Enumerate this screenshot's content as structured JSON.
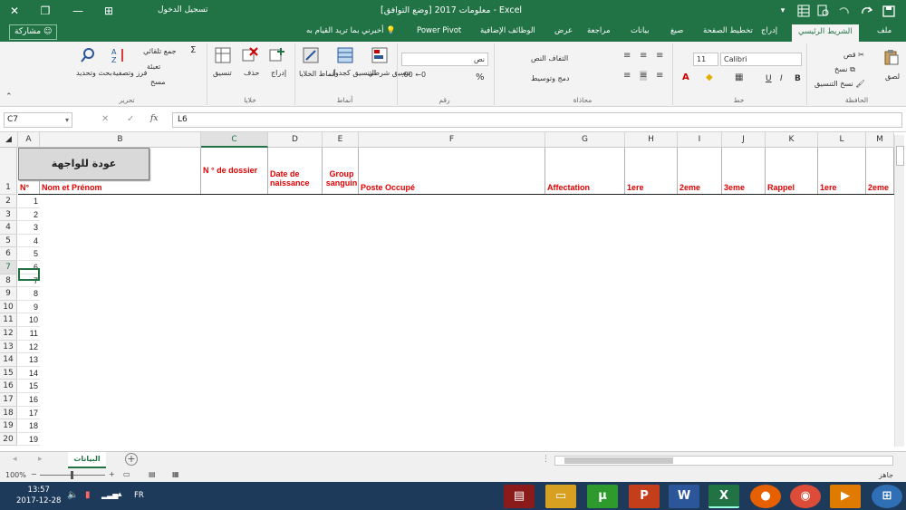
{
  "window": {
    "title": "معلومات 2017  [وضع التوافق]  -  Excel",
    "signin": "تسجيل الدخول",
    "close_glyph": "✕",
    "restore_glyph": "❐",
    "minimize_glyph": "—",
    "ribbon_display_glyph": "⊞"
  },
  "tabs": {
    "file": "ملف",
    "home": "الشريط الرئيسي",
    "insert": "إدراج",
    "page_layout": "تخطيط الصفحة",
    "formulas": "صيغ",
    "data": "بيانات",
    "review": "مراجعة",
    "view": "عرض",
    "addins": "الوظائف الإضافية",
    "power_pivot": "Power Pivot",
    "tell_me": "أخبرني بما تريد القيام به",
    "share": "مشاركة"
  },
  "ribbon": {
    "clipboard": {
      "label": "الحافظة",
      "paste": "لصق",
      "cut": "قص",
      "copy": "نسخ",
      "format_painter": "نسخ التنسيق"
    },
    "font": {
      "label": "خط",
      "name": "Calibri",
      "size": "11",
      "bold": "B",
      "italic": "I",
      "underline": "U"
    },
    "alignment": {
      "label": "محاذاة",
      "wrap_text": "التفاف النص",
      "merge_center": "دمج وتوسيط"
    },
    "number": {
      "label": "رقم",
      "format": "نص",
      "percent": "%"
    },
    "styles": {
      "label": "أنماط",
      "conditional": "تنسيق شرطي",
      "format_table": "التنسيق كجدول",
      "cell_styles": "أنماط الخلايا"
    },
    "cells": {
      "label": "خلايا",
      "insert": "إدراج",
      "delete": "حذف",
      "format": "تنسيق"
    },
    "editing": {
      "label": "تحرير",
      "autosum": "جمع تلقائي",
      "fill": "تعبئة",
      "clear": "مسح",
      "sort_filter": "فرز وتصفية",
      "find_select": "بحث وتحديد"
    }
  },
  "formula_bar": {
    "name_box": "C7",
    "formula": "L6",
    "fx": "fx"
  },
  "columns": [
    {
      "id": "A",
      "header": "N°"
    },
    {
      "id": "B",
      "header": "Nom et Prénom"
    },
    {
      "id": "C",
      "header": "N ° de dossier"
    },
    {
      "id": "D",
      "header": "Date de naissance"
    },
    {
      "id": "E",
      "header": "Group sanguin"
    },
    {
      "id": "F",
      "header": "Poste Occupé"
    },
    {
      "id": "G",
      "header": "Affectation"
    },
    {
      "id": "H",
      "header": "1ere"
    },
    {
      "id": "I",
      "header": "2eme"
    },
    {
      "id": "J",
      "header": "3eme"
    },
    {
      "id": "K",
      "header": "Rappel"
    },
    {
      "id": "L",
      "header": "1ere"
    },
    {
      "id": "M",
      "header": "2eme"
    }
  ],
  "rows": [
    "1",
    "2",
    "3",
    "4",
    "5",
    "6",
    "7",
    "8",
    "9",
    "10",
    "11",
    "12",
    "13",
    "14",
    "15",
    "16",
    "17",
    "18",
    "19",
    "20"
  ],
  "row_values": [
    "1",
    "2",
    "3",
    "4",
    "5",
    "6",
    "7",
    "8",
    "9",
    "10",
    "11",
    "12",
    "13",
    "14",
    "15",
    "16",
    "17",
    "18",
    "19"
  ],
  "shape_button": "عودة للواجهة",
  "sheet_tab": "البيانات",
  "status": {
    "ready": "جاهز",
    "zoom": "100%"
  },
  "taskbar": {
    "time": "13:57",
    "date": "2017-12-28",
    "lang": "FR"
  }
}
